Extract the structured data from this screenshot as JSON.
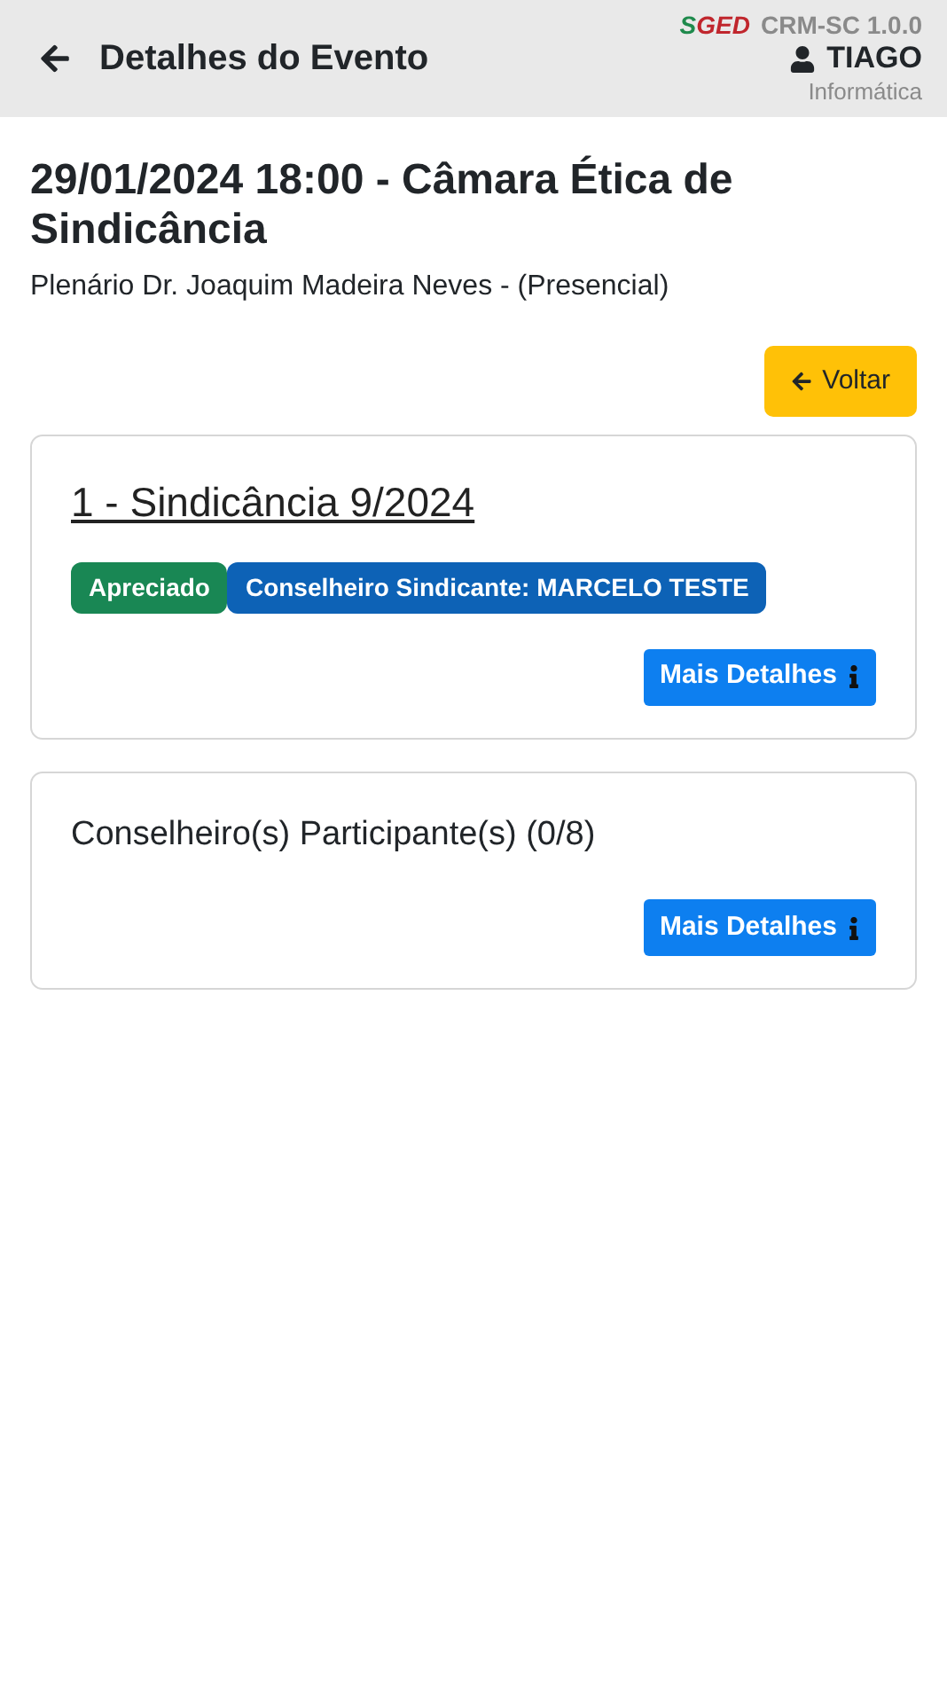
{
  "header": {
    "title": "Detalhes do Evento",
    "logo": [
      "S",
      "GED"
    ],
    "version": "CRM-SC 1.0.0",
    "user": "TIAGO",
    "department": "Informática"
  },
  "event": {
    "title": "29/01/2024 18:00 - Câmara Ética de Sindicância",
    "location": "Plenário Dr. Joaquim Madeira Neves - (Presencial)",
    "back_button": "Voltar"
  },
  "cards": [
    {
      "kind": "process",
      "title": "1 - Sindicância 9/2024",
      "badges": [
        {
          "label": "Apreciado",
          "color": "#198754"
        },
        {
          "label": "Conselheiro Sindicante: MARCELO TESTE",
          "color": "#0d62b6"
        }
      ],
      "button": "Mais Detalhes"
    },
    {
      "kind": "participants",
      "title": "Conselheiro(s) Participante(s) (0/8)",
      "button": "Mais Detalhes"
    }
  ]
}
